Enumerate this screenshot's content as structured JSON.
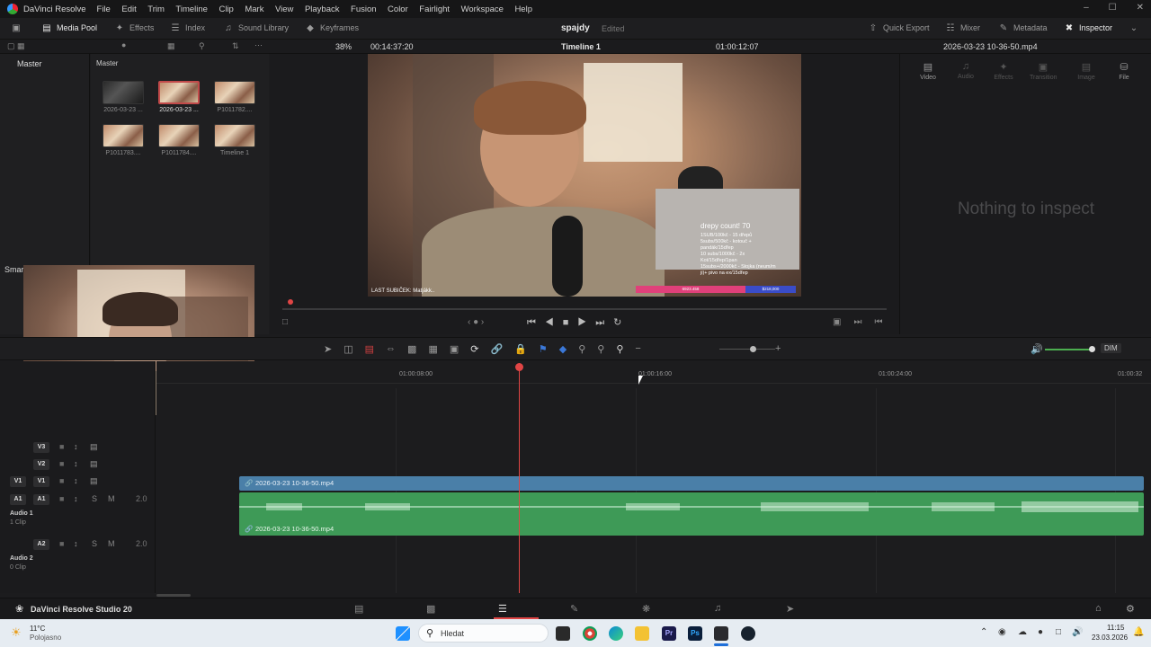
{
  "titlebar": {
    "app": "DaVinci Resolve",
    "menu": [
      "File",
      "Edit",
      "Trim",
      "Timeline",
      "Clip",
      "Mark",
      "View",
      "Playback",
      "Fusion",
      "Color",
      "Fairlight",
      "Workspace",
      "Help"
    ],
    "win_min": "–",
    "win_max": "☐",
    "win_close": "✕"
  },
  "toolbar": {
    "media_pool": "Media Pool",
    "effects": "Effects",
    "index": "Index",
    "sound_library": "Sound Library",
    "keyframes": "Keyframes",
    "project": "spajdy",
    "status": "Edited",
    "quick_export": "Quick Export",
    "mixer": "Mixer",
    "metadata": "Metadata",
    "inspector": "Inspector"
  },
  "bar2": {
    "zoom": "38%",
    "source_tc": "00:14:37:20",
    "timeline": "Timeline 1",
    "record_tc": "01:00:12:07",
    "clip_name": "2026-03-23 10-36-50.mp4"
  },
  "bins": {
    "master": "Master",
    "smart": "Smar"
  },
  "pool": {
    "title": "Master",
    "clips": [
      {
        "label": "2026-03-23 ...",
        "dark": true,
        "selected": false
      },
      {
        "label": "2026-03-23 ...",
        "dark": false,
        "selected": true
      },
      {
        "label": "P1011782....",
        "dark": false,
        "selected": false
      },
      {
        "label": "P1011783....",
        "dark": false,
        "selected": false
      },
      {
        "label": "P1011784....",
        "dark": false,
        "selected": false
      },
      {
        "label": "Timeline 1",
        "dark": false,
        "selected": false
      }
    ]
  },
  "video_overlay": {
    "count": "drepy count! 70",
    "lines": [
      "1SUB/100kč - 15 dřepů",
      "5subs/500kč - kotouč +",
      "pandák/15dřep",
      "10 subs/1000kč - 2x",
      "Kot/15dřep/1pan",
      "15subs+/2000kč - Stojka (neum/m",
      "ji)+ pivo na ex/15dřep"
    ],
    "last_sub": "LAST SUBIČEK: Matjákk..",
    "bar_left": "6923.458",
    "bar_right": "$218,000"
  },
  "inspector": {
    "tabs": [
      "Video",
      "Audio",
      "Effects",
      "Transition",
      "Image",
      "File"
    ],
    "empty": "Nothing to inspect"
  },
  "timeline": {
    "ruler": [
      "01:00:08:00",
      "01:00:16:00",
      "01:00:24:00",
      "01:00:32"
    ],
    "tracks": {
      "v3": "V3",
      "v2": "V2",
      "v1": "V1",
      "v1_src": "V1",
      "a1": "A1",
      "a1_src": "A1",
      "a1_name": "Audio 1",
      "a1_clips": "1 Clip",
      "a1_level": "2.0",
      "a2": "A2",
      "a2_name": "Audio 2",
      "a2_clips": "0 Clip",
      "a2_level": "2.0",
      "solo": "S",
      "mute": "M"
    },
    "video_clip": "2026-03-23 10-36-50.mp4",
    "audio_clip": "2026-03-23 10-36-50.mp4",
    "dim": "DIM"
  },
  "statusbar": {
    "app": "DaVinci Resolve Studio 20"
  },
  "taskbar": {
    "temp": "11°C",
    "weather": "Polojasno",
    "search": "Hledat",
    "time": "11:15",
    "date": "23.03.2026"
  },
  "colors": {
    "playhead": "#e04545",
    "video_clip": "#4a7fa8",
    "audio_clip": "#3e9a57",
    "accent": "#c24a4a"
  }
}
